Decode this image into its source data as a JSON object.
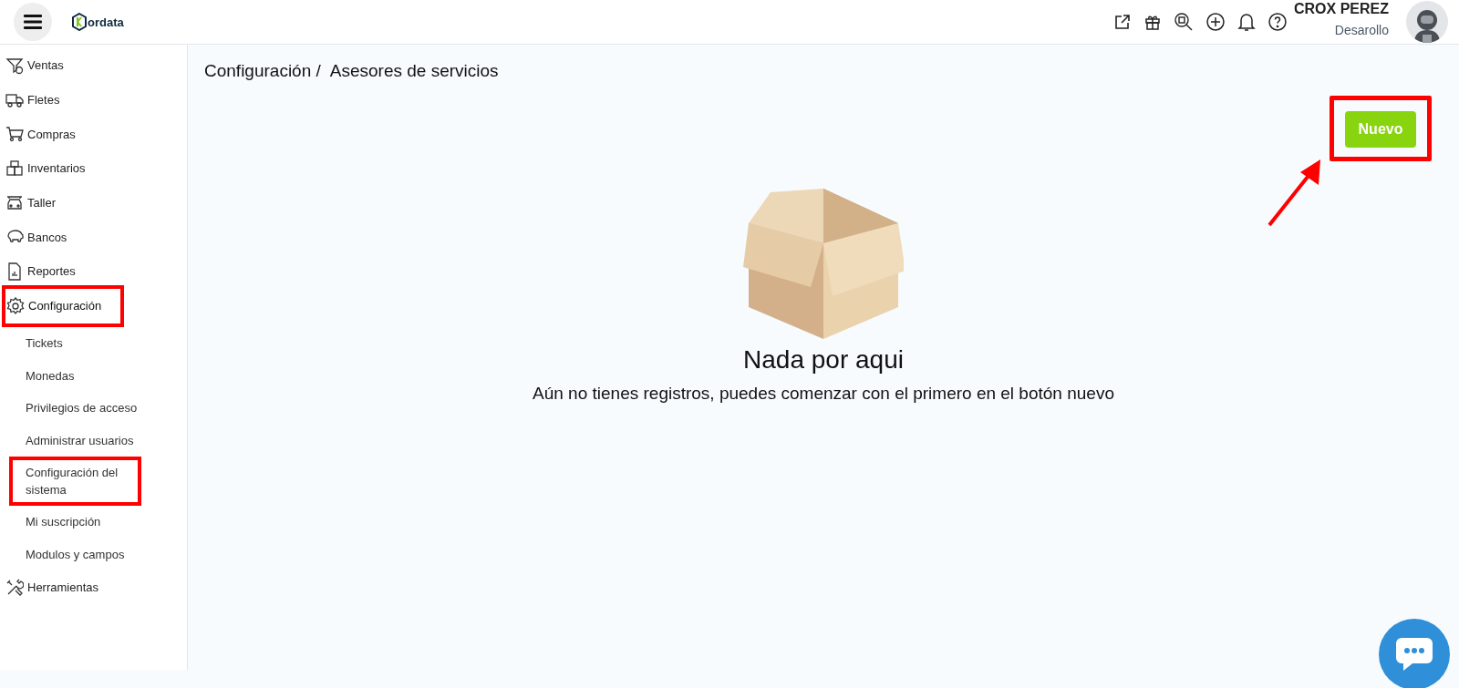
{
  "header": {
    "logo": "ordata",
    "user_name": "CROX PEREZ",
    "user_role": "Desarollo"
  },
  "sidebar": {
    "items": [
      {
        "label": "Ventas",
        "selected": false,
        "highlighted": false
      },
      {
        "label": "Fletes",
        "selected": false,
        "highlighted": false
      },
      {
        "label": "Compras",
        "selected": false,
        "highlighted": false
      },
      {
        "label": "Inventarios",
        "selected": false,
        "highlighted": false
      },
      {
        "label": "Taller",
        "selected": false,
        "highlighted": false
      },
      {
        "label": "Bancos",
        "selected": false,
        "highlighted": false
      },
      {
        "label": "Reportes",
        "selected": false,
        "highlighted": false
      },
      {
        "label": "Configuración",
        "selected": true,
        "highlighted": true,
        "children": [
          {
            "label": "Tickets",
            "highlighted": false
          },
          {
            "label": "Monedas",
            "highlighted": false
          },
          {
            "label": "Privilegios de acceso",
            "highlighted": false
          },
          {
            "label": "Administrar usuarios",
            "highlighted": false
          },
          {
            "label": "Configuración del sistema",
            "highlighted": true
          },
          {
            "label": "Mi suscripción",
            "highlighted": false
          },
          {
            "label": "Modulos y campos",
            "highlighted": false
          }
        ]
      },
      {
        "label": "Herramientas",
        "selected": false,
        "highlighted": false
      }
    ]
  },
  "breadcrumb": [
    "Configuración /",
    "Asesores de servicios"
  ],
  "new_button": {
    "label": "Nuevo",
    "highlighted": true,
    "arrow": true
  },
  "empty_state": {
    "title": "Nada por aqui",
    "message": "Aún no tienes registros, puedes comenzar con el primero en el botón nuevo"
  }
}
